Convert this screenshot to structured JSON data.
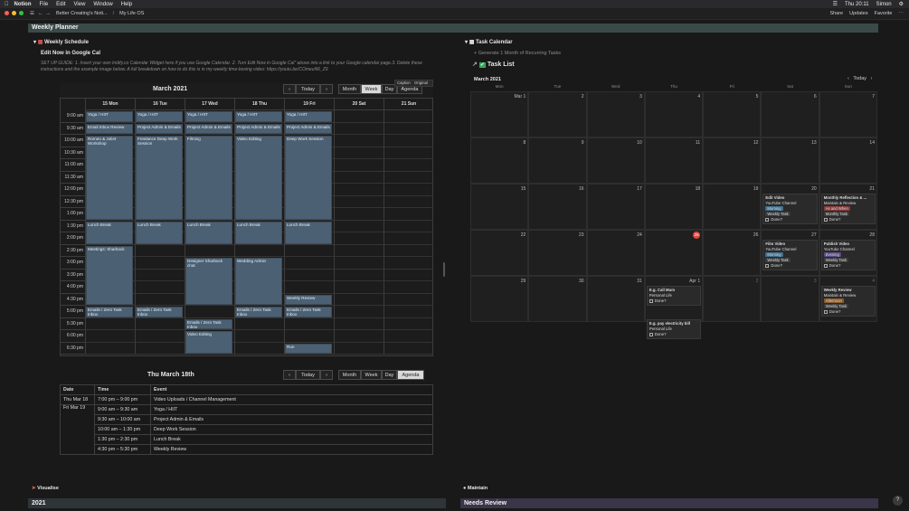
{
  "menubar": {
    "app": "Notion",
    "items": [
      "File",
      "Edit",
      "View",
      "Window",
      "Help"
    ],
    "clock": "Thu 20:11",
    "user": "Simon"
  },
  "tabbar": {
    "breadcrumb1": "Better Creating's Noti...",
    "breadcrumb2": "My Life OS",
    "share": "Share",
    "updates": "Updates",
    "favorite": "Favorite"
  },
  "page": {
    "title": "Weekly Planner"
  },
  "weekly": {
    "toggle_label": "Weekly Schedule",
    "edit_label": "Edit Now in Google Cal",
    "guide": "SET UP GUIDE: 1. Insert your own Indify.co Calendar Widget here if you use Google Calendar. 2. Turn Edit Now in Google Cal\" above into a link to your Google calendar page.3. Delete these instructions and the example image below. A full breakdown on how to do this is in my weekly time-boxing video: https://youtu.be/COmeuN6_Z9",
    "month_title": "March 2021",
    "today": "Today",
    "views": [
      "Month",
      "Week",
      "Day",
      "Agenda"
    ],
    "days": [
      "15 Mon",
      "16 Tue",
      "17 Wed",
      "18 Thu",
      "19 Fri",
      "20 Sat",
      "21 Sun"
    ],
    "times": [
      "9:00 am",
      "9:30 am",
      "10:00 am",
      "10:30 am",
      "11:00 am",
      "11:30 am",
      "12:00 pm",
      "12:30 pm",
      "1:00 pm",
      "1:30 pm",
      "2:00 pm",
      "2:30 pm",
      "3:00 pm",
      "3:30 pm",
      "4:00 pm",
      "4:30 pm",
      "5:00 pm",
      "5:30 pm",
      "6:00 pm",
      "6:30 pm"
    ],
    "toolbar": {
      "caption": "Caption",
      "original": "Original"
    }
  },
  "week_events": [
    {
      "day": 0,
      "start": 0,
      "len": 1,
      "text": "Yoga / HIIT"
    },
    {
      "day": 0,
      "start": 1,
      "len": 1,
      "text": "Email Inbox Review"
    },
    {
      "day": 0,
      "start": 2,
      "len": 7,
      "text": "Romeo & Juliet Workshop"
    },
    {
      "day": 0,
      "start": 9,
      "len": 2,
      "text": "Lunch Break"
    },
    {
      "day": 0,
      "start": 11,
      "len": 5,
      "text": "Meetings: Sharbock"
    },
    {
      "day": 0,
      "start": 16,
      "len": 1,
      "text": "Emails / Zero Task Inbox"
    },
    {
      "day": 1,
      "start": 0,
      "len": 1,
      "text": "Yoga / HIIT"
    },
    {
      "day": 1,
      "start": 1,
      "len": 1,
      "text": "Project Admin & Emails"
    },
    {
      "day": 1,
      "start": 2,
      "len": 7,
      "text": "Freelance Deep Work Session"
    },
    {
      "day": 1,
      "start": 9,
      "len": 2,
      "text": "Lunch Break"
    },
    {
      "day": 1,
      "start": 16,
      "len": 1,
      "text": "Emails / Zero Task Inbox"
    },
    {
      "day": 2,
      "start": 0,
      "len": 1,
      "text": "Yoga / HIIT"
    },
    {
      "day": 2,
      "start": 1,
      "len": 1,
      "text": "Project Admin & Emails"
    },
    {
      "day": 2,
      "start": 2,
      "len": 7,
      "text": "Filming"
    },
    {
      "day": 2,
      "start": 9,
      "len": 2,
      "text": "Lunch Break"
    },
    {
      "day": 2,
      "start": 12,
      "len": 4,
      "text": "Designer Sharbock chat"
    },
    {
      "day": 2,
      "start": 17,
      "len": 1,
      "text": "Emails / Zero Task Inbox"
    },
    {
      "day": 2,
      "start": 18,
      "len": 2,
      "text": "Video Editing"
    },
    {
      "day": 3,
      "start": 0,
      "len": 1,
      "text": "Yoga / HIIT"
    },
    {
      "day": 3,
      "start": 1,
      "len": 1,
      "text": "Project Admin & Emails"
    },
    {
      "day": 3,
      "start": 2,
      "len": 7,
      "text": "Video Editing"
    },
    {
      "day": 3,
      "start": 9,
      "len": 2,
      "text": "Lunch Break"
    },
    {
      "day": 3,
      "start": 12,
      "len": 4,
      "text": "Wedding Admin"
    },
    {
      "day": 3,
      "start": 16,
      "len": 1,
      "text": "Emails / Zero Task Inbox"
    },
    {
      "day": 4,
      "start": 0,
      "len": 1,
      "text": "Yoga / HIIT"
    },
    {
      "day": 4,
      "start": 1,
      "len": 1,
      "text": "Project Admin & Emails"
    },
    {
      "day": 4,
      "start": 2,
      "len": 7,
      "text": "Deep Work Session"
    },
    {
      "day": 4,
      "start": 9,
      "len": 2,
      "text": "Lunch Break"
    },
    {
      "day": 4,
      "start": 15,
      "len": 1,
      "text": "Weekly Review"
    },
    {
      "day": 4,
      "start": 16,
      "len": 1,
      "text": "Emails / Zero Task Inbox"
    },
    {
      "day": 4,
      "start": 19,
      "len": 1,
      "text": "Run"
    }
  ],
  "agenda": {
    "title": "Thu March 18th",
    "headers": [
      "Date",
      "Time",
      "Event"
    ],
    "rows": [
      [
        "Thu Mar 18",
        "7:00 pm – 9:00 pm",
        "Video Uploads / Channel Management"
      ],
      [
        "Fri Mar 19",
        "9:00 am – 9:30 am",
        "Yoga / HIIT"
      ],
      [
        "",
        "9:30 am – 10:00 am",
        "Project Admin & Emails"
      ],
      [
        "",
        "10:00 am – 1:30 pm",
        "Deep Work Session"
      ],
      [
        "",
        "1:30 pm – 2:30 pm",
        "Lunch Break"
      ],
      [
        "",
        "4:30 pm – 5:30 pm",
        "Weekly Review"
      ]
    ]
  },
  "task_calendar": {
    "toggle_label": "Task Calendar",
    "generate": "Generate 1 Month of Recurring Tasks",
    "list_title": "Task List",
    "month": "March 2021",
    "today": "Today",
    "weekdays": [
      "Mon",
      "Tue",
      "Wed",
      "Thu",
      "Fri",
      "Sat",
      "Sun"
    ],
    "weeks": [
      [
        "Mar 1",
        "2",
        "3",
        "4",
        "5",
        "6",
        "7"
      ],
      [
        "8",
        "9",
        "10",
        "11",
        "12",
        "13",
        "14"
      ],
      [
        "15",
        "16",
        "17",
        "18",
        "19",
        "20",
        "21"
      ],
      [
        "22",
        "23",
        "24",
        "25",
        "26",
        "27",
        "28"
      ],
      [
        "29",
        "30",
        "31",
        "Apr 1",
        "2",
        "3",
        "4"
      ]
    ],
    "today_index": [
      3,
      3
    ]
  },
  "task_cards": [
    {
      "week": 2,
      "day": 5,
      "title": "Edit Video",
      "rel": "YouTube Channel",
      "tag": "Morning",
      "tagcolor": "#3f6e8e",
      "type": "Weekly Task",
      "done": "Done?"
    },
    {
      "week": 2,
      "day": 6,
      "title": "Monthly Reflection & ...",
      "rel": "Maintain & Review",
      "tag": "As and When",
      "tagcolor": "#8a3a3a",
      "type": "Monthly Task",
      "done": "Done?"
    },
    {
      "week": 3,
      "day": 5,
      "title": "Film Video",
      "rel": "YouTube Channel",
      "tag": "Morning",
      "tagcolor": "#3f6e8e",
      "type": "Weekly Task",
      "done": "Done?"
    },
    {
      "week": 3,
      "day": 6,
      "title": "Publish Video",
      "rel": "YouTube Channel",
      "tag": "Evening",
      "tagcolor": "#5b4a86",
      "type": "Weekly Task",
      "done": "Done?"
    },
    {
      "week": 4,
      "day": 3,
      "title": "E.g. Call Mum",
      "rel": "Personal Life",
      "tag": "",
      "tagcolor": "",
      "type": "",
      "done": "Done?"
    },
    {
      "week": 4,
      "day": 3,
      "title": "E.g. pay electricity bill",
      "rel": "Personal Life",
      "tag": "",
      "tagcolor": "",
      "type": "",
      "done": "Done?",
      "second": true
    },
    {
      "week": 4,
      "day": 6,
      "title": "Weekly Review",
      "rel": "Maintain & Review",
      "tag": "Afternoon",
      "tagcolor": "#8a5a2a",
      "type": "Weekly Task",
      "done": "Done?"
    }
  ],
  "bottom": {
    "visualise": "Visualise",
    "year": "2021",
    "maintain": "Maintain",
    "needs_review": "Needs Review"
  },
  "help": "?"
}
